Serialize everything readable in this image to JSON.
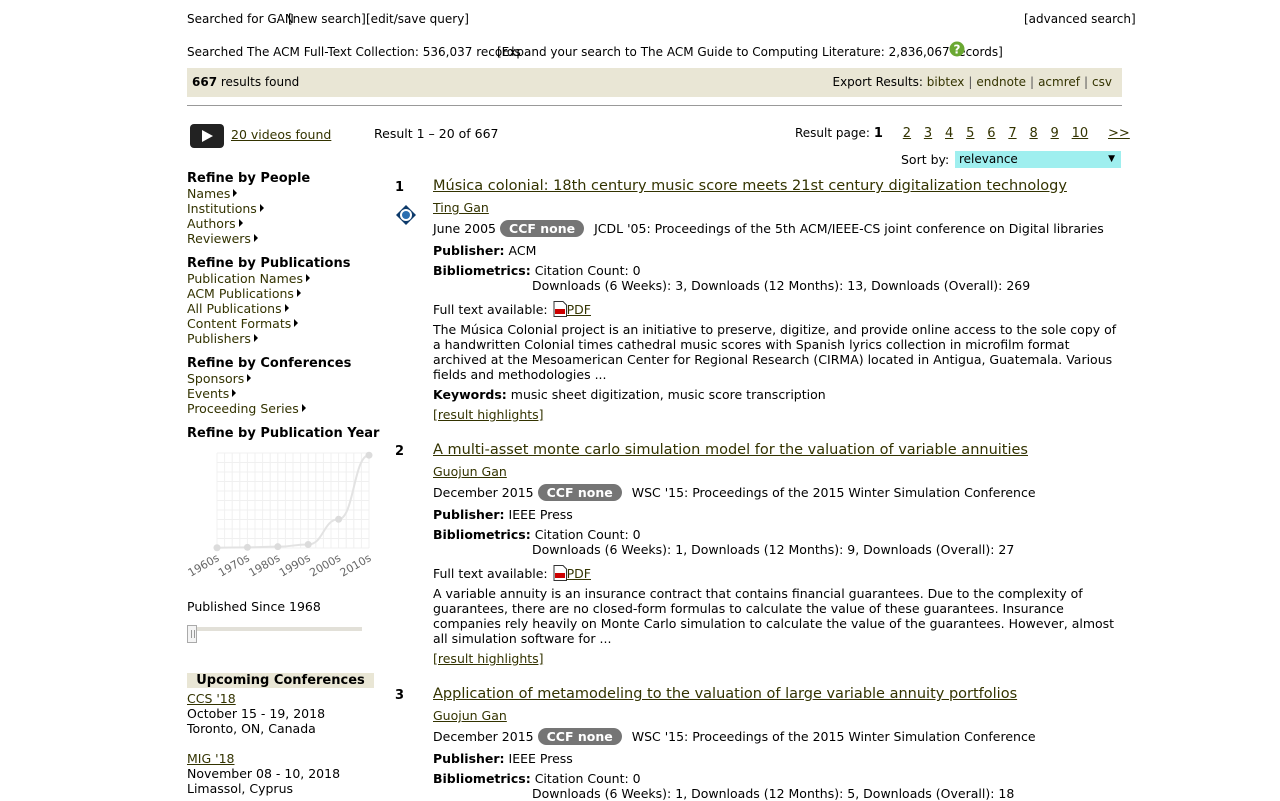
{
  "search": {
    "searched_for_label": "Searched for GAN",
    "new_search": "[new search]",
    "edit_save": "[edit/save query]",
    "advanced": "[advanced search]",
    "collection_text": "Searched The ACM Full-Text Collection: 536,037 records",
    "expand_text": "[Expand your search to The ACM Guide to Computing Literature: 2,836,067 records]"
  },
  "results_bar": {
    "count": "667",
    "count_suffix": " results found",
    "export_label": "Export Results: ",
    "export_links": [
      "bibtex",
      "endnote",
      "acmref",
      "csv"
    ]
  },
  "videos": {
    "label": "20 videos found"
  },
  "result_range": "Result 1 – 20 of 667",
  "pager": {
    "label": "Result page:",
    "current": "1",
    "pages": [
      "2",
      "3",
      "4",
      "5",
      "6",
      "7",
      "8",
      "9",
      "10"
    ],
    "next": ">>"
  },
  "sort": {
    "label": "Sort by:",
    "value": "relevance"
  },
  "sidebar": {
    "people": {
      "heading": "Refine by People",
      "items": [
        "Names",
        "Institutions",
        "Authors",
        "Reviewers"
      ]
    },
    "publications": {
      "heading": "Refine by Publications",
      "items": [
        "Publication Names",
        "ACM Publications",
        "All Publications",
        "Content Formats",
        "Publishers"
      ]
    },
    "conferences": {
      "heading": "Refine by Conferences",
      "items": [
        "Sponsors",
        "Events",
        "Proceeding Series"
      ]
    },
    "year": {
      "heading": "Refine by Publication Year"
    },
    "published_since": "Published Since 1968",
    "upcoming": {
      "heading": "Upcoming Conferences",
      "items": [
        {
          "name": "CCS '18",
          "dates": "October 15 - 19, 2018",
          "location": "Toronto, ON, Canada"
        },
        {
          "name": "MIG '18",
          "dates": "November 08 - 10, 2018",
          "location": "Limassol, Cyprus"
        }
      ]
    }
  },
  "chart_data": {
    "type": "line",
    "categories": [
      "1960s",
      "1970s",
      "1980s",
      "1990s",
      "2000s",
      "2010s"
    ],
    "values": [
      1,
      3,
      6,
      16,
      130,
      420
    ],
    "ylim": [
      0,
      430
    ],
    "grid": true
  },
  "labels": {
    "publisher": "Publisher:",
    "bibliometrics": "Bibliometrics:",
    "fulltext": "Full text available:",
    "pdf": "PDF",
    "keywords": "Keywords:",
    "highlights": "[result highlights]"
  },
  "results": [
    {
      "num": "1",
      "title": "Música colonial: 18th century music score meets 21st century digitalization technology",
      "author": "Ting Gan",
      "date": "June 2005",
      "ccf": "CCF none",
      "venue": "JCDL '05: Proceedings of the 5th ACM/IEEE-CS joint conference on Digital libraries",
      "publisher": "ACM",
      "citation": "Citation Count: 0",
      "downloads": "Downloads (6 Weeks): 3,   Downloads (12 Months): 13,   Downloads (Overall): 269",
      "abstract": "The Música Colonial project is an initiative to preserve, digitize, and provide online access to the sole copy of a handwritten Colonial times cathedral music scores with Spanish lyrics collection in microfilm format archived at the Mesoamerican Center for Regional Research (CIRMA) located in Antigua, Guatemala. Various fields and methodologies ...",
      "keywords": "music sheet digitization, music score transcription"
    },
    {
      "num": "2",
      "title": "A multi-asset monte carlo simulation model for the valuation of variable annuities",
      "author": "Guojun Gan",
      "date": "December 2015",
      "ccf": "CCF none",
      "venue": "WSC '15: Proceedings of the 2015 Winter Simulation Conference",
      "publisher": "IEEE Press",
      "citation": "Citation Count: 0",
      "downloads": "Downloads (6 Weeks): 1,   Downloads (12 Months): 9,   Downloads (Overall): 27",
      "abstract": "A variable annuity is an insurance contract that contains financial guarantees. Due to the complexity of guarantees, there are no closed-form formulas to calculate the value of these guarantees. Insurance companies rely heavily on Monte Carlo simulation to calculate the value of the guarantees. However, almost all simulation software for ..."
    },
    {
      "num": "3",
      "title": "Application of metamodeling to the valuation of large variable annuity portfolios",
      "author": "Guojun Gan",
      "date": "December 2015",
      "ccf": "CCF none",
      "venue": "WSC '15: Proceedings of the 2015 Winter Simulation Conference",
      "publisher": "IEEE Press",
      "citation": "Citation Count: 0",
      "downloads": "Downloads (6 Weeks): 1,   Downloads (12 Months): 5,   Downloads (Overall): 18"
    }
  ]
}
